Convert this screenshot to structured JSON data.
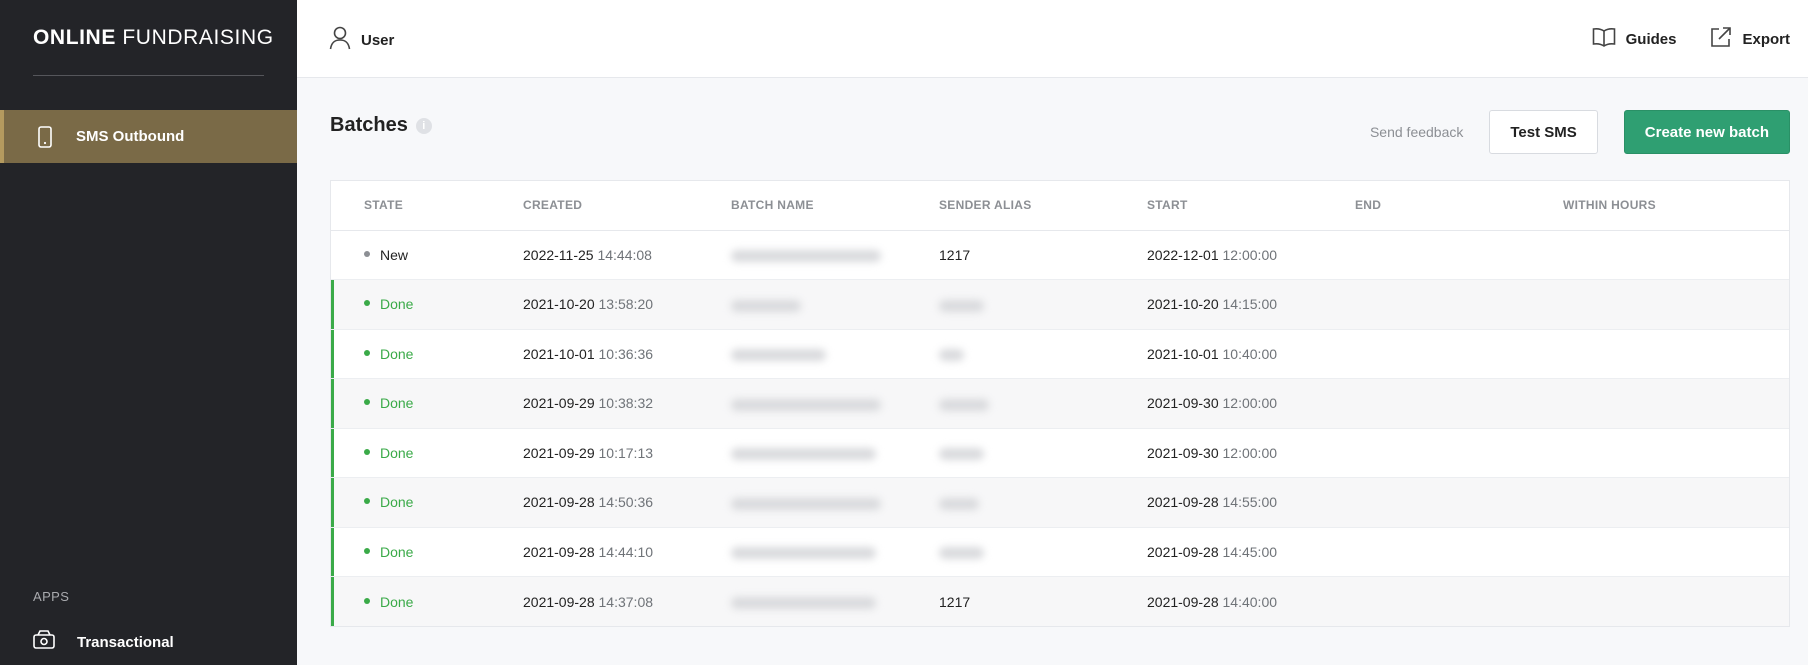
{
  "sidebar": {
    "brand_bold": "ONLINE",
    "brand_light": "FUNDRAISING",
    "active_item": {
      "label": "SMS Outbound",
      "icon": "mobile-phone-icon"
    },
    "apps_heading": "APPS",
    "apps_items": [
      {
        "label": "Transactional",
        "icon": "money-icon"
      }
    ],
    "colors": {
      "background": "#232428",
      "active": "#7a6a47"
    }
  },
  "topbar": {
    "user_label": "User",
    "guides_label": "Guides",
    "export_label": "Export"
  },
  "main": {
    "title": "Batches",
    "info_glyph": "i",
    "feedback_label": "Send feedback",
    "test_sms_label": "Test SMS",
    "create_label": "Create new batch",
    "accent": "#2f9f72"
  },
  "table": {
    "columns": [
      "STATE",
      "CREATED",
      "BATCH NAME",
      "SENDER ALIAS",
      "START",
      "END",
      "WITHIN HOURS"
    ],
    "rows": [
      {
        "state": "New",
        "created_date": "2022-11-25",
        "created_time": "14:44:08",
        "batch_name": "",
        "sender_alias": "1217",
        "start_date": "2022-12-01",
        "start_time": "12:00:00",
        "end": "",
        "within_hours": ""
      },
      {
        "state": "Done",
        "created_date": "2021-10-20",
        "created_time": "13:58:20",
        "batch_name": "",
        "sender_alias": "",
        "start_date": "2021-10-20",
        "start_time": "14:15:00",
        "end": "",
        "within_hours": ""
      },
      {
        "state": "Done",
        "created_date": "2021-10-01",
        "created_time": "10:36:36",
        "batch_name": "",
        "sender_alias": "",
        "start_date": "2021-10-01",
        "start_time": "10:40:00",
        "end": "",
        "within_hours": ""
      },
      {
        "state": "Done",
        "created_date": "2021-09-29",
        "created_time": "10:38:32",
        "batch_name": "",
        "sender_alias": "",
        "start_date": "2021-09-30",
        "start_time": "12:00:00",
        "end": "",
        "within_hours": ""
      },
      {
        "state": "Done",
        "created_date": "2021-09-29",
        "created_time": "10:17:13",
        "batch_name": "",
        "sender_alias": "",
        "start_date": "2021-09-30",
        "start_time": "12:00:00",
        "end": "",
        "within_hours": ""
      },
      {
        "state": "Done",
        "created_date": "2021-09-28",
        "created_time": "14:50:36",
        "batch_name": "",
        "sender_alias": "",
        "start_date": "2021-09-28",
        "start_time": "14:55:00",
        "end": "",
        "within_hours": ""
      },
      {
        "state": "Done",
        "created_date": "2021-09-28",
        "created_time": "14:44:10",
        "batch_name": "",
        "sender_alias": "",
        "start_date": "2021-09-28",
        "start_time": "14:45:00",
        "end": "",
        "within_hours": ""
      },
      {
        "state": "Done",
        "created_date": "2021-09-28",
        "created_time": "14:37:08",
        "batch_name": "",
        "sender_alias": "1217",
        "start_date": "2021-09-28",
        "start_time": "14:40:00",
        "end": "",
        "within_hours": ""
      }
    ],
    "colors": {
      "done": "#3aaa48",
      "new": "#8c8f94"
    }
  }
}
